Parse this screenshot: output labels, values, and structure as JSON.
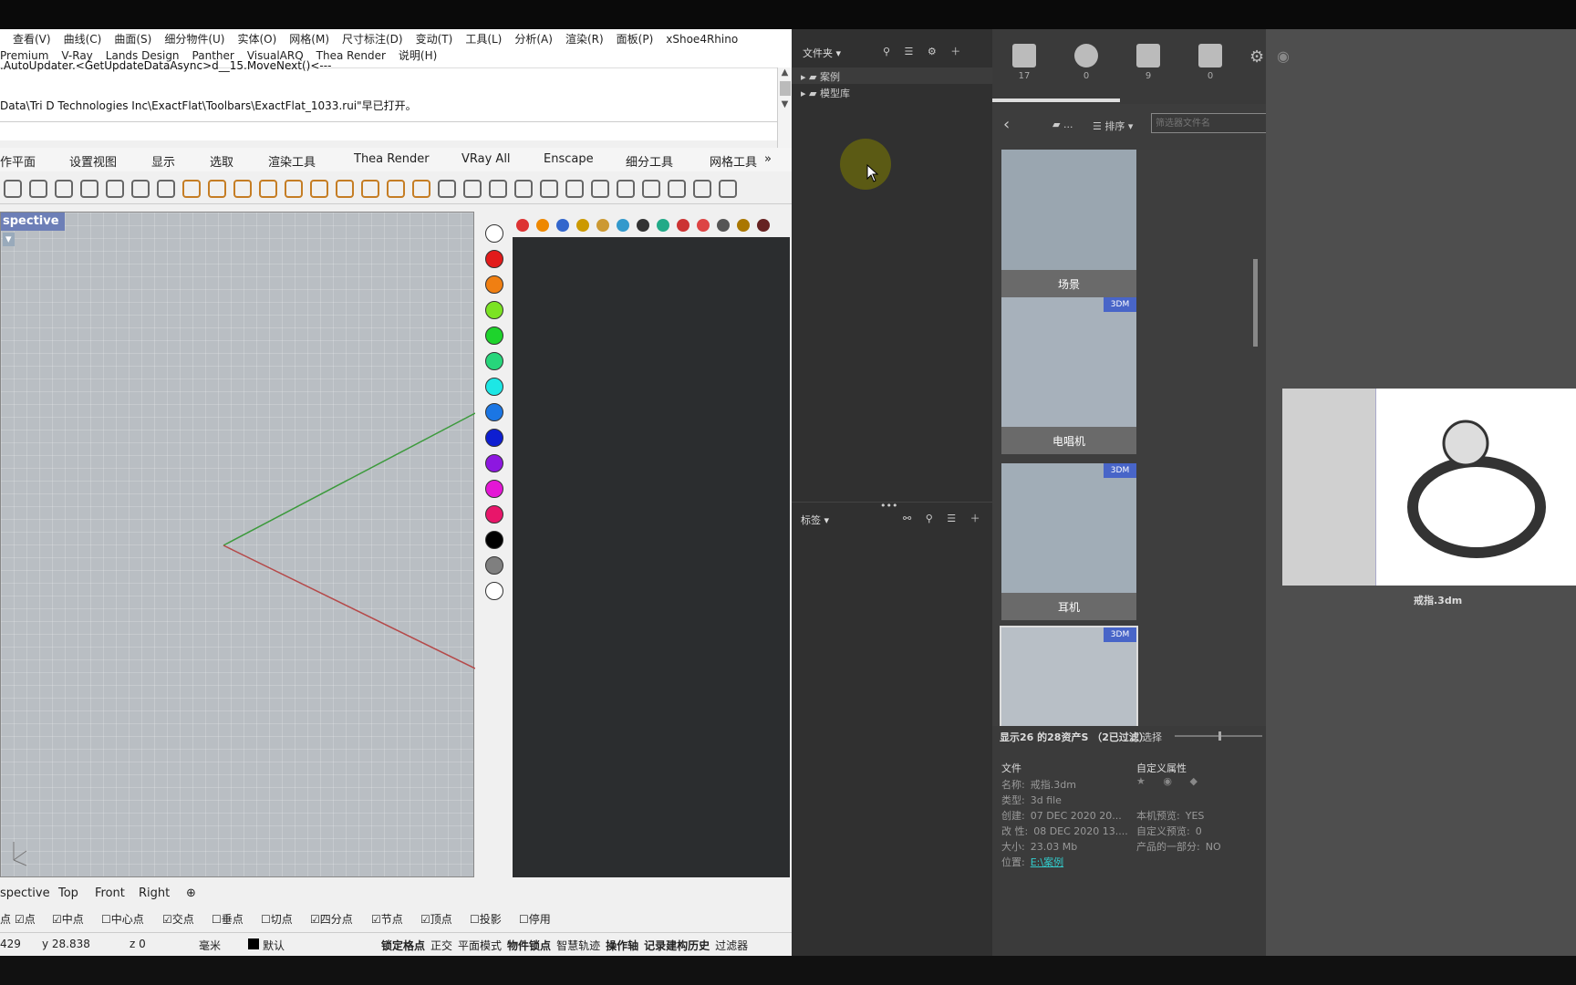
{
  "rhino": {
    "menu_row1": [
      "查看(V)",
      "曲线(C)",
      "曲面(S)",
      "细分物件(U)",
      "实体(O)",
      "网格(M)",
      "尺寸标注(D)",
      "变动(T)",
      "工具(L)",
      "分析(A)",
      "渲染(R)",
      "面板(P)",
      "xShoe4Rhino"
    ],
    "menu_row2": [
      "Premium",
      "V-Ray",
      "Lands Design",
      "Panther",
      "VisualARQ",
      "Thea Render",
      "说明(H)"
    ],
    "cmd_line1": ".AutoUpdater.<GetUpdateDataAsync>d__15.MoveNext()<---",
    "cmd_line2": "Data\\Tri D Technologies Inc\\ExactFlat\\Toolbars\\ExactFlat_1033.rui\"早已打开。",
    "toolbar_tabs": [
      "作平面",
      "设置视图",
      "显示",
      "选取",
      "渲染工具",
      "Thea Render",
      "VRay All",
      "Enscape",
      "细分工具",
      "网格工具",
      "»"
    ],
    "viewport_title": "spective",
    "view_tabs": [
      "spective",
      "Top",
      "Front",
      "Right",
      "⊕"
    ],
    "osnaps": [
      {
        "label": "点",
        "checked": true
      },
      {
        "label": "中点",
        "checked": true
      },
      {
        "label": "中心点",
        "checked": false
      },
      {
        "label": "交点",
        "checked": true
      },
      {
        "label": "垂点",
        "checked": false
      },
      {
        "label": "切点",
        "checked": false
      },
      {
        "label": "四分点",
        "checked": true
      },
      {
        "label": "节点",
        "checked": true
      },
      {
        "label": "顶点",
        "checked": true
      },
      {
        "label": "投影",
        "checked": false
      },
      {
        "label": "停用",
        "checked": false
      }
    ],
    "osnap_prefix": "点",
    "status": {
      "x": "429",
      "y": "y 28.838",
      "z": "z 0",
      "unit": "毫米",
      "layer": "默认",
      "modes": [
        "锁定格点",
        "正交",
        "平面模式",
        "物件锁点",
        "智慧轨迹",
        "操作轴",
        "记录建构历史",
        "过滤器"
      ]
    },
    "swatch_colors": [
      "#ffffff",
      "#e21b1b",
      "#f07f12",
      "#7be323",
      "#1ed32c",
      "#27d67b",
      "#1de7e5",
      "#1b76e4",
      "#0e1ed1",
      "#8d17e0",
      "#e416d5",
      "#e8166a",
      "#000000",
      "#7f7f7f",
      "#ffffff"
    ]
  },
  "library": {
    "folders_label": "文件夹",
    "tree": [
      "案例",
      "模型库"
    ],
    "tags_label": "标签",
    "categories": [
      {
        "icon": "cube-icon",
        "count": "17"
      },
      {
        "icon": "sphere-icon",
        "count": "0"
      },
      {
        "icon": "image-icon",
        "count": "9"
      },
      {
        "icon": "film-icon",
        "count": "0"
      }
    ],
    "breadcrumb": "...",
    "sort_label": "排序",
    "filter_placeholder": "筛选器文件名",
    "cards": [
      {
        "label": "场景",
        "badge": ""
      },
      {
        "label": "电唱机",
        "badge": "3DM"
      },
      {
        "label": "耳机",
        "badge": "3DM"
      },
      {
        "label": "",
        "badge": "3DM"
      }
    ],
    "count_text": "显示26 的28资产S （2已过滤）",
    "select_label": "选择",
    "file_header": "文件",
    "custom_header": "自定义属性",
    "file_info": [
      {
        "k": "名称:",
        "v": "戒指.3dm"
      },
      {
        "k": "类型:",
        "v": "3d file"
      },
      {
        "k": "创建:",
        "v": "07 DEC 2020 20..."
      },
      {
        "k": "改 性:",
        "v": "08 DEC 2020 13...."
      },
      {
        "k": "大小:",
        "v": "23.03 Mb"
      },
      {
        "k": "位置:",
        "v": "E:\\案例"
      }
    ],
    "custom_info": [
      {
        "k": "本机预览:",
        "v": "YES"
      },
      {
        "k": "自定义预览:",
        "v": "0"
      },
      {
        "k": "产品的一部分:",
        "v": "NO"
      }
    ],
    "preview_label": "戒指.3dm"
  }
}
